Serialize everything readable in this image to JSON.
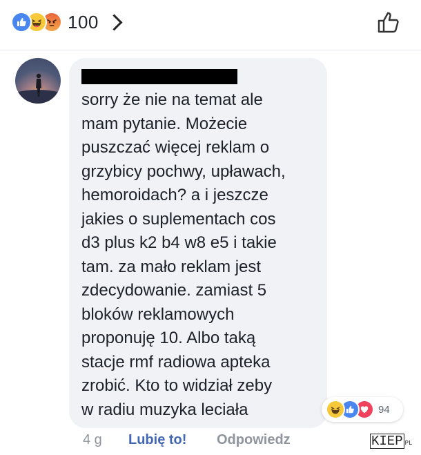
{
  "header": {
    "reaction_icons": [
      "like-icon",
      "haha-icon",
      "angry-icon"
    ],
    "reaction_count": "100",
    "thumbs_icon": "thumbs-up-outline-icon"
  },
  "comment": {
    "author_name": "",
    "lines": [
      "sorry że nie na temat ale",
      "mam pytanie. Możecie",
      "puszczać więcej reklam o",
      "grzybicy pochwy, upławach,",
      "hemoroidach? a i jeszcze",
      "jakies o suplementach cos",
      "d3 plus k2 b4 w8 e5 i takie",
      "tam. za mało reklam jest",
      "zdecydowanie. zamiast 5",
      "bloków reklamowych",
      "proponuję 10. Albo taką",
      "stacje rmf radiowa apteka",
      "zrobić. Kto to widział zeby",
      "w radiu muzyka leciała"
    ],
    "reactions": {
      "icons": [
        "haha-icon",
        "like-icon",
        "love-icon"
      ],
      "count": "94"
    },
    "time": "4 g",
    "like_label": "Lubię to!",
    "reply_label": "Odpowiedz"
  },
  "watermark": {
    "main": "KIEP",
    "suffix": "PL"
  },
  "colors": {
    "like_blue": "#4a86f0",
    "link_blue": "#4267b2",
    "bubble_bg": "#f0f2f5",
    "meta_grey": "#90949c"
  }
}
